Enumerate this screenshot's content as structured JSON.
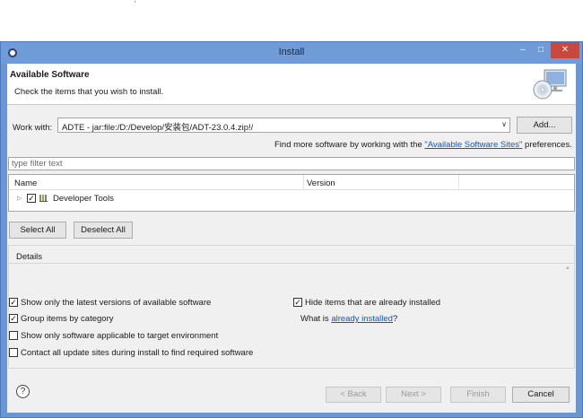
{
  "top_mark": "'",
  "window": {
    "title": "Install",
    "controls": {
      "minimize": "–",
      "maximize": "□",
      "close": "✕"
    }
  },
  "banner": {
    "title": "Available Software",
    "description": "Check the items that you wish to install.",
    "icon": "install-monitor-cd-icon"
  },
  "work_with": {
    "label": "Work with:",
    "value": "ADTE - jar:file:/D:/Develop/安装包/ADT-23.0.4.zip!/",
    "add_button": "Add..."
  },
  "find_more": {
    "prefix": "Find more software by working with the ",
    "link": "\"Available Software Sites\"",
    "suffix": " preferences."
  },
  "filter": {
    "placeholder": "type filter text"
  },
  "tree": {
    "columns": [
      "Name",
      "Version"
    ],
    "rows": [
      {
        "label": "Developer Tools",
        "version": "",
        "checked": true,
        "expanded": false
      }
    ]
  },
  "selection_buttons": {
    "select_all": "Select All",
    "deselect_all": "Deselect All"
  },
  "details": {
    "legend": "Details",
    "options": [
      {
        "label": "Show only the latest versions of available software",
        "checked": true
      },
      {
        "label": "Group items by category",
        "checked": true
      },
      {
        "label": "Show only software applicable to target environment",
        "checked": false
      },
      {
        "label": "Contact all update sites during install to find required software",
        "checked": false
      },
      {
        "label": "Hide items that are already installed",
        "checked": true
      }
    ],
    "what_is": {
      "prefix": "What is ",
      "link": "already installed",
      "suffix": "?"
    }
  },
  "footer": {
    "help": "?",
    "back": "< Back",
    "next": "Next >",
    "finish": "Finish",
    "cancel": "Cancel"
  },
  "colors": {
    "title_bar": "#6f9bd6",
    "close_button": "#c9473c",
    "link": "#0a5bc4",
    "dialog_body": "#f0f0f0"
  }
}
